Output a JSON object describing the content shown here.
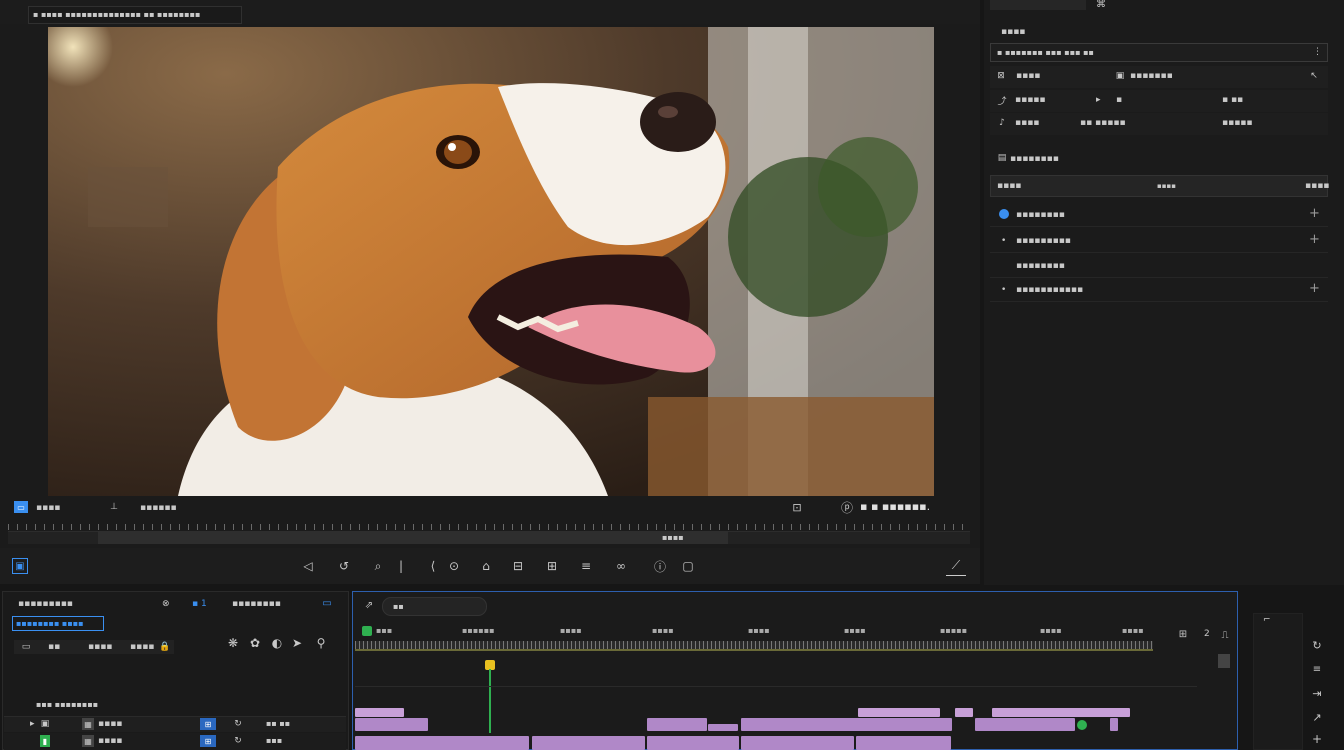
{
  "topbar": {
    "tab_text": "▪ ▪▪▪▪ ▪▪▪▪▪▪▪▪▪▪▪▪▪▪ ▪▪ ▪▪▪▪▪▪▪▪"
  },
  "preview": {
    "track_label": "▪▪▪▪",
    "zoom_label": "▪▪▪▪▪▪",
    "timecode": "▪ ▪ ▪▪▪▪▪▪.",
    "scrub_label": "▪▪▪▪"
  },
  "right": {
    "section_title": "▪▪▪▪",
    "path_field": "▪ ▪▪▪▪▪▪▪ ▪▪▪ ▪▪▪ ▪▪",
    "grid": [
      [
        "▪▪▪▪",
        "▪▪▪▪▪▪▪",
        ""
      ],
      [
        "▪▪▪▪▪",
        "▪",
        "▪ ▪▪"
      ],
      [
        "▪▪▪▪",
        "▪▪ ▪▪▪▪▪",
        "▪▪▪▪▪"
      ]
    ],
    "subheading": "▪▪▪▪▪▪▪▪",
    "table_header": [
      "▪▪▪▪",
      "▪▪▪▪",
      "▪▪▪▪"
    ],
    "effects": [
      "▪▪▪▪▪▪▪▪",
      "▪▪▪▪▪▪▪▪▪",
      "▪▪▪▪▪▪▪▪",
      "▪▪▪▪▪▪▪▪▪▪▪"
    ]
  },
  "project": {
    "title": "▪▪▪▪▪▪▪▪▪",
    "count": "▪ 1",
    "bin_label": "▪▪▪▪▪▪▪▪",
    "filter": "▪▪▪▪▪▪▪▪ ▪▪▪▪",
    "cols": [
      "▪▪",
      "▪▪▪▪",
      "▪▪▪▪"
    ],
    "footer": "▪▪▪ ▪▪▪▪▪▪▪▪",
    "rows": [
      {
        "name": "▪▪▪▪",
        "val": "▪▪ ▪▪"
      },
      {
        "name": "▪▪▪▪",
        "val": "▪▪▪"
      }
    ]
  },
  "timeline": {
    "search": "▪▪",
    "ticks": [
      "▪▪▪",
      "▪▪▪▪▪▪",
      "▪▪▪▪",
      "▪▪▪▪",
      "▪▪▪▪",
      "▪▪▪▪",
      "▪▪▪▪▪",
      "▪▪▪▪",
      "▪▪▪▪"
    ],
    "num": "2"
  },
  "colors": {
    "accent": "#3a8ff0",
    "clip": "#c8a0d8",
    "playhead": "#3cc86a",
    "marker": "#e8c020"
  }
}
